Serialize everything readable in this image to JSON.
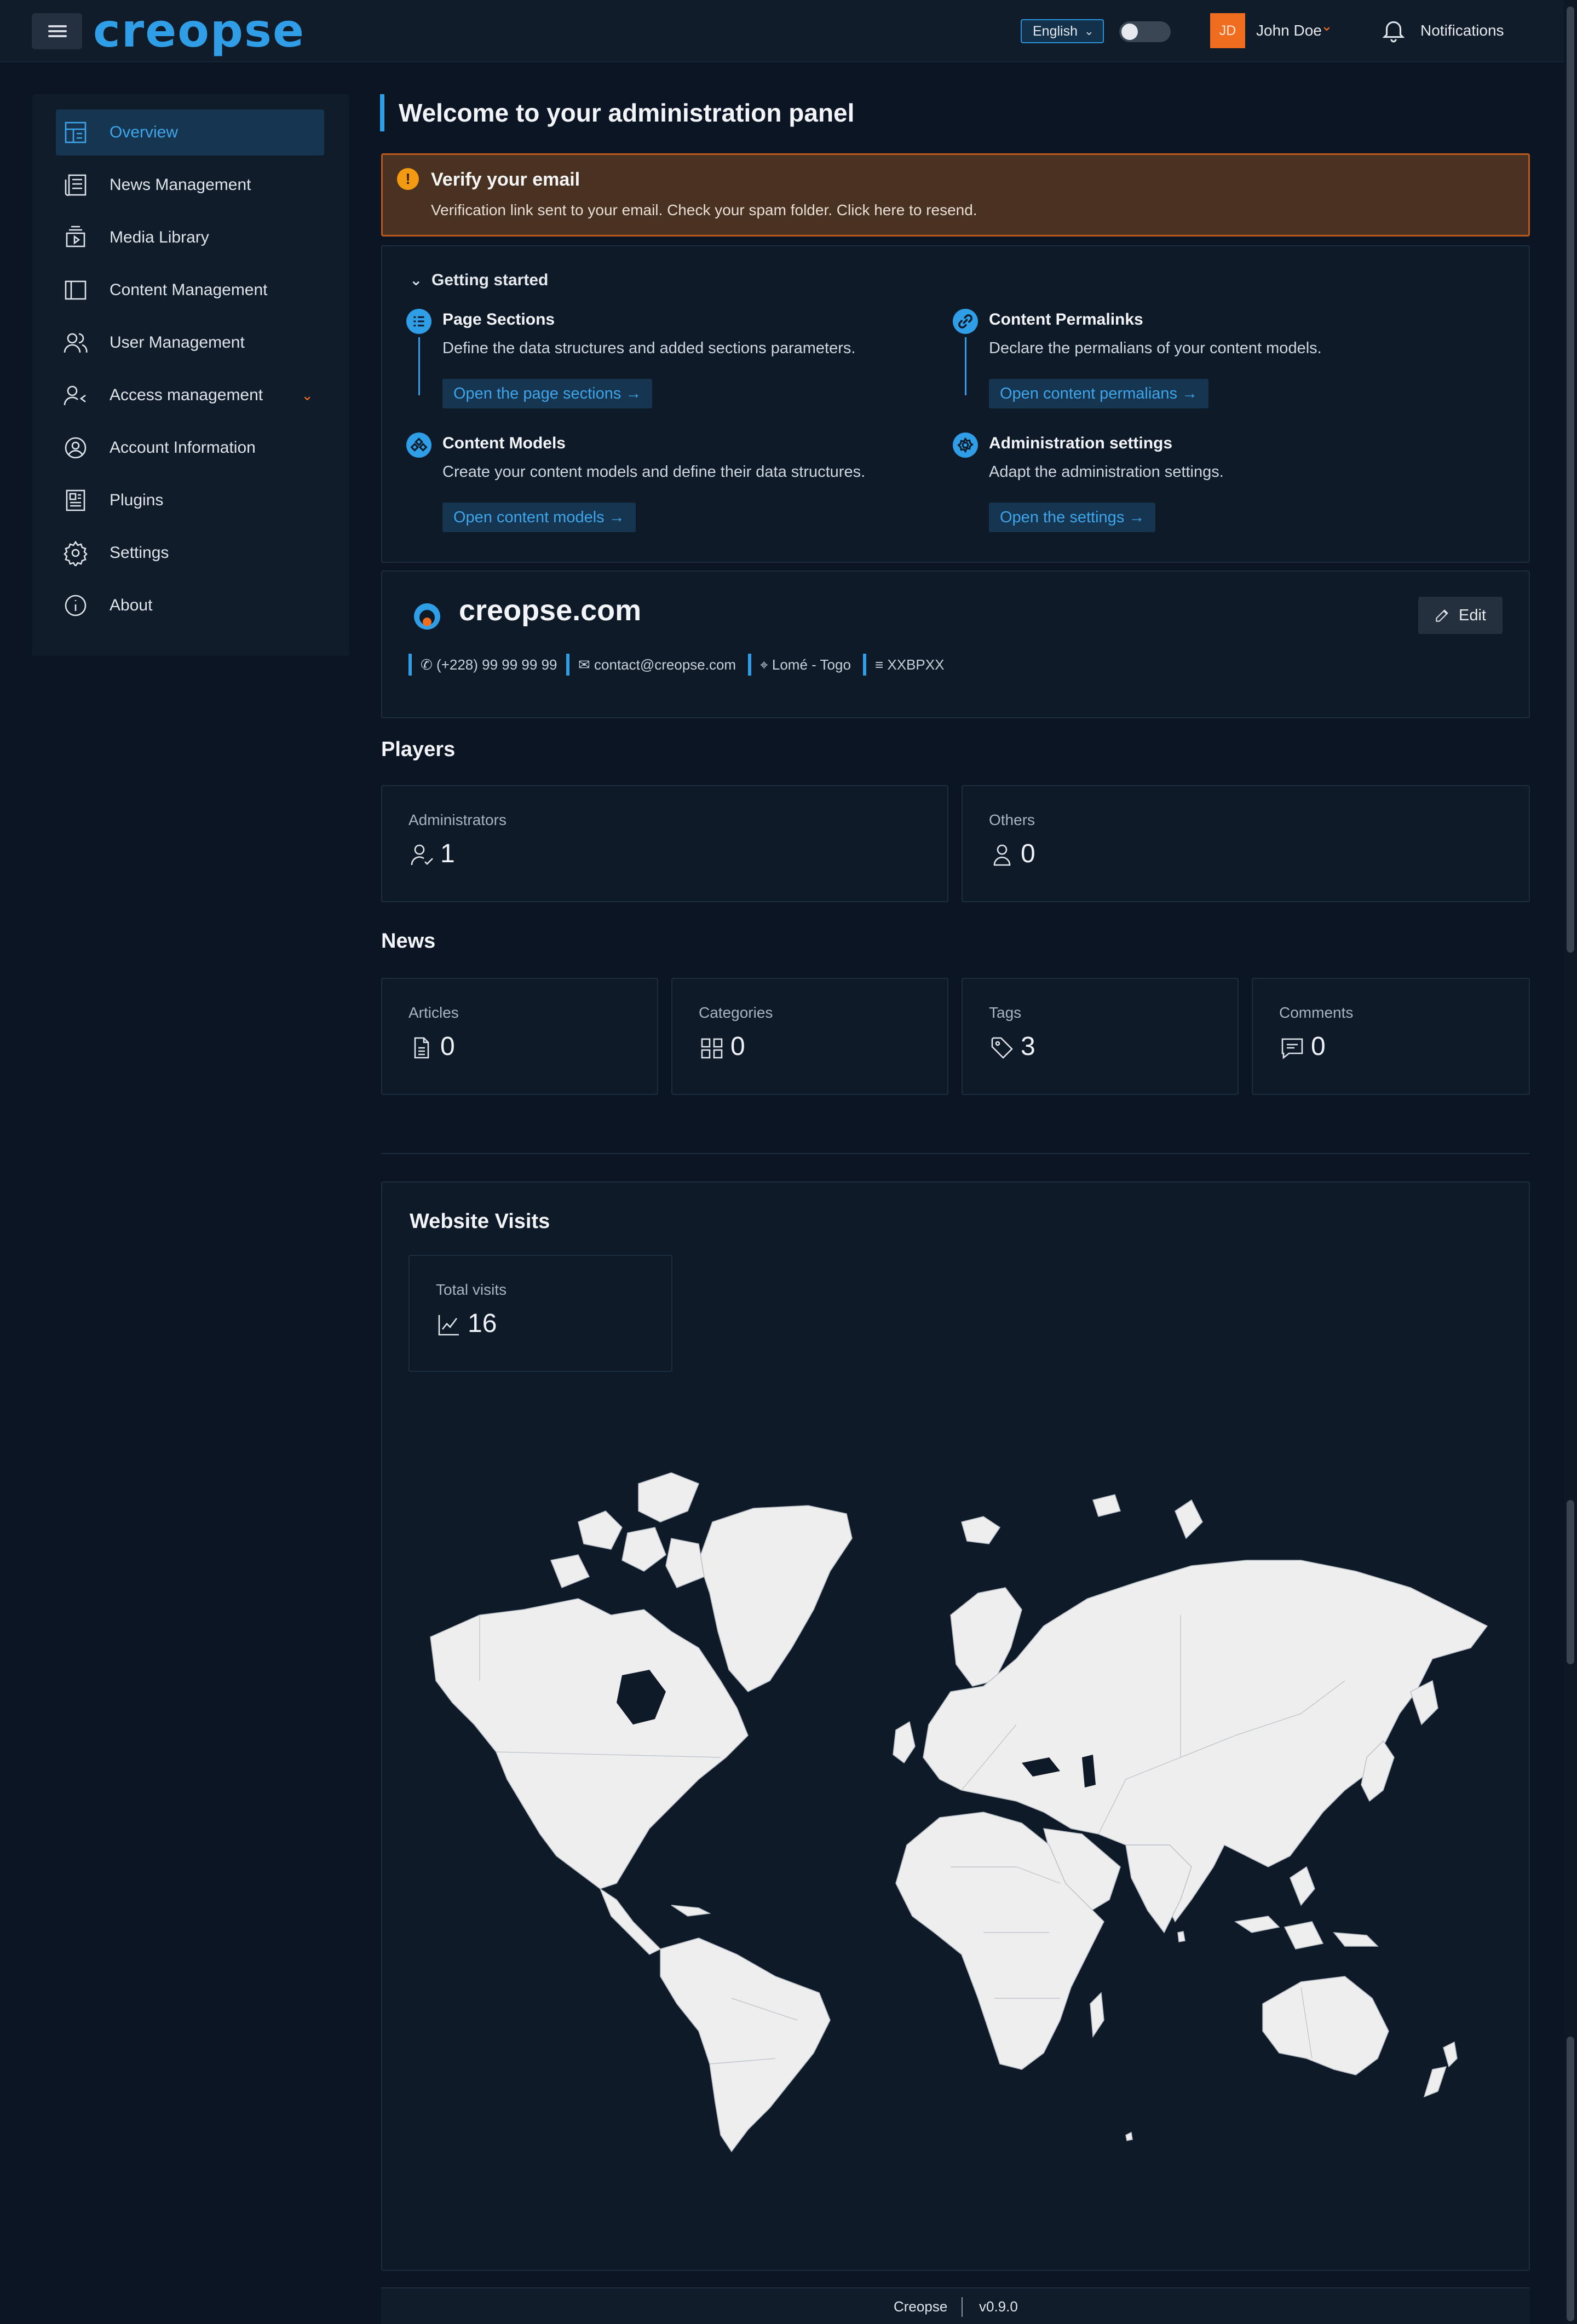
{
  "brand": {
    "logo_text": "creopse",
    "accent_color": "#2f9ee6",
    "orange_color": "#f06c1f"
  },
  "header": {
    "language": "English",
    "user_initials": "JD",
    "user_name": "John Doe",
    "notifications_label": "Notifications"
  },
  "sidebar": {
    "items": [
      {
        "label": "Overview",
        "icon": "dashboard-icon",
        "active": true
      },
      {
        "label": "News Management",
        "icon": "newspaper-icon"
      },
      {
        "label": "Media Library",
        "icon": "media-icon"
      },
      {
        "label": "Content Management",
        "icon": "layout-icon"
      },
      {
        "label": "User Management",
        "icon": "users-icon"
      },
      {
        "label": "Access management",
        "icon": "user-access-icon",
        "expandable": true
      },
      {
        "label": "Account Information",
        "icon": "account-circle-icon"
      },
      {
        "label": "Plugins",
        "icon": "plugins-icon"
      },
      {
        "label": "Settings",
        "icon": "gear-icon"
      },
      {
        "label": "About",
        "icon": "info-icon"
      }
    ]
  },
  "main": {
    "welcome_title": "Welcome to your administration panel",
    "verify": {
      "title": "Verify your email",
      "text": "Verification link sent to your email. Check your spam folder. Click here to resend."
    },
    "getting_started": {
      "title": "Getting started",
      "steps": [
        {
          "title": "Page Sections",
          "desc": "Define the data structures and added sections parameters.",
          "link": "Open the page sections"
        },
        {
          "title": "Content Permalinks",
          "desc": "Declare the permalians of your content models.",
          "link": "Open content permalians"
        },
        {
          "title": "Content Models",
          "desc": "Create your content models and define their data structures.",
          "link": "Open content models"
        },
        {
          "title": "Administration settings",
          "desc": "Adapt the administration settings.",
          "link": "Open the settings"
        }
      ]
    },
    "site": {
      "name": "creopse.com",
      "edit_label": "Edit",
      "phone": "(+228) 99 99 99 99",
      "email": "contact@creopse.com",
      "location": "Lomé - Togo",
      "code": "XXBPXX"
    },
    "players": {
      "title": "Players",
      "stats": [
        {
          "label": "Administrators",
          "value": "1",
          "icon": "user-check-icon"
        },
        {
          "label": "Others",
          "value": "0",
          "icon": "user-icon"
        }
      ]
    },
    "news": {
      "title": "News",
      "stats": [
        {
          "label": "Articles",
          "value": "0",
          "icon": "document-icon"
        },
        {
          "label": "Categories",
          "value": "0",
          "icon": "categories-icon"
        },
        {
          "label": "Tags",
          "value": "3",
          "icon": "tag-icon"
        },
        {
          "label": "Comments",
          "value": "0",
          "icon": "comment-icon"
        }
      ]
    },
    "visits": {
      "title": "Website Visits",
      "total_label": "Total visits",
      "total_value": "16",
      "map_icon": "world-map"
    }
  },
  "footer": {
    "brand": "Creopse",
    "version": "v0.9.0"
  }
}
